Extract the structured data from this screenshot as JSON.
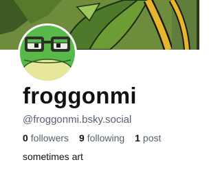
{
  "profile": {
    "display_name": "froggonmi",
    "handle": "@froggonmi.bsky.social",
    "bio": "sometimes art",
    "stats": [
      {
        "count": "0",
        "label": "followers"
      },
      {
        "count": "9",
        "label": "following"
      },
      {
        "count": "1",
        "label": "post"
      }
    ]
  },
  "icons": {
    "avatar": "frog-with-glasses-avatar",
    "banner": "illustrated-banner-image"
  },
  "colors": {
    "frog_green": "#59b84a",
    "frog_belly": "#e6e79a",
    "banner_green": "#6f8c3d",
    "banner_gold": "#e8b62e",
    "handle_gray": "#566270"
  }
}
